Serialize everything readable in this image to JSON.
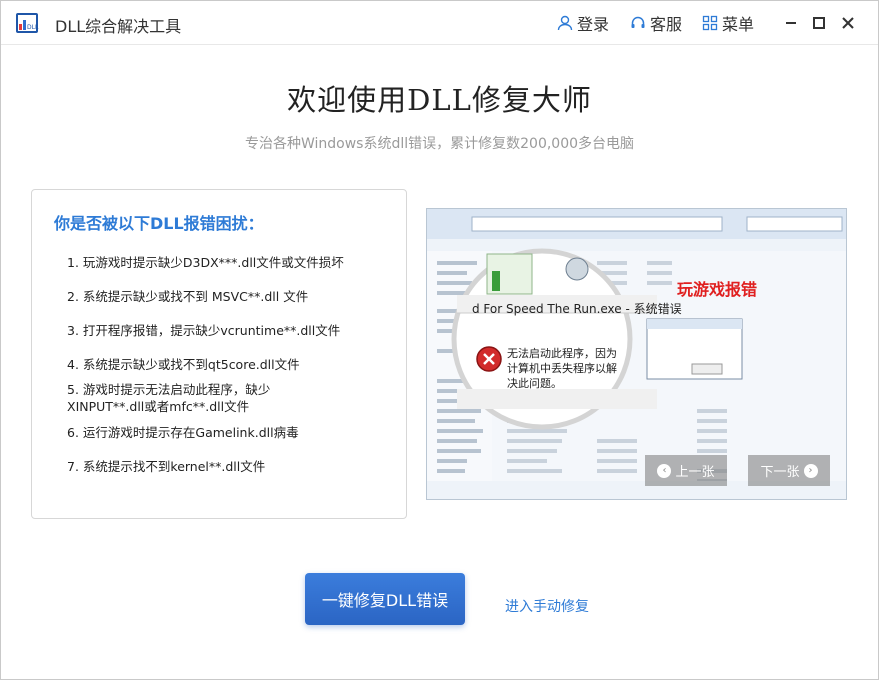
{
  "titlebar": {
    "app_title": "DLL综合解决工具",
    "login_label": "登录",
    "service_label": "客服",
    "menu_label": "菜单"
  },
  "main": {
    "title": "欢迎使用DLL修复大师",
    "subtitle": "专治各种Windows系统dll错误，累计修复数200,000多台电脑"
  },
  "issues_card": {
    "title": "你是否被以下DLL报错困扰：",
    "items": [
      "1. 玩游戏时提示缺少D3DX***.dll文件或文件损坏",
      "2. 系统提示缺少或找不到 MSVC**.dll 文件",
      "3. 打开程序报错，提示缺少vcruntime**.dll文件",
      "4. 系统提示缺少或找不到qt5core.dll文件",
      "5. 游戏时提示无法启动此程序，缺少XINPUT**.dll或者mfc**.dll文件",
      "6. 运行游戏时提示存在Gamelink.dll病毒",
      "7. 系统提示找不到kernel**.dll文件"
    ]
  },
  "screenshot": {
    "label": "玩游戏报错",
    "error_title": "d For Speed The Run.exe - 系统错误",
    "error_message": "无法启动此程序，因为计算机中丢失程序以解决此问题。",
    "prev_label": "上一张",
    "next_label": "下一张"
  },
  "actions": {
    "fix_button": "一键修复DLL错误",
    "manual_link": "进入手动修复"
  },
  "colors": {
    "accent": "#2e7bd6",
    "primary_button": "#2f6fcf",
    "error_label": "#e02020"
  }
}
